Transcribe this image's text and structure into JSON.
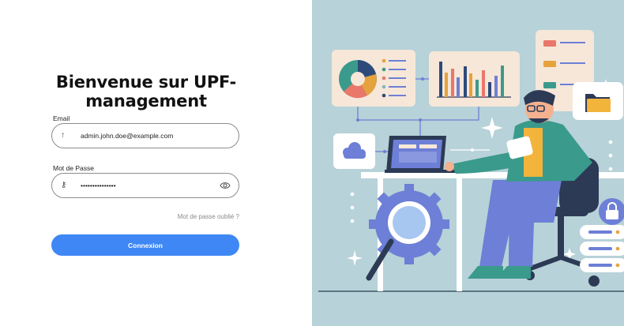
{
  "login": {
    "title": "Bienvenue sur UPF-management",
    "email_label": "Email",
    "email_value": "admin.john.doe@example.com",
    "password_label": "Mot de Passe",
    "password_value": "•••••••••••••••",
    "forgot_password": "Mot de passe oublié ?",
    "submit_label": "Connexion"
  },
  "icons": {
    "email_field": "arrow-up-icon",
    "password_field": "key-icon",
    "visibility_toggle": "eye-icon"
  },
  "colors": {
    "accent": "#3f87f5",
    "illustration_background": "#b7d2d8",
    "title_text": "#111111",
    "muted_text": "#8a8a8a"
  }
}
